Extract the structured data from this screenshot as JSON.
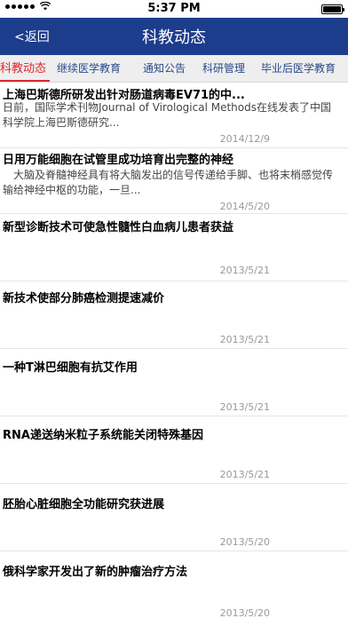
{
  "status_bar": {
    "time": "5:37 PM",
    "signal_icon": "signal-dots-icon",
    "wifi_icon": "wifi-icon",
    "battery_icon": "battery-icon"
  },
  "nav": {
    "back_label": "<返回",
    "title": "科教动态"
  },
  "tabs": [
    {
      "label": "科教动态",
      "active": true
    },
    {
      "label": "继续医学教育"
    },
    {
      "label": "通知公告"
    },
    {
      "label": "科研管理"
    },
    {
      "label": "毕业后医学教育"
    }
  ],
  "news": [
    {
      "title": "上海巴斯德所研发出针对肠道病毒EV71的中...",
      "summary": "日前，国际学术刊物Journal of Virological Methods在线发表了中国科学院上海巴斯德研究...",
      "date": "2014/12/9"
    },
    {
      "title": "日用万能细胞在试管里成功培育出完整的神经",
      "summary": "大脑及脊髓神经具有将大脑发出的信号传递给手脚、也将末梢感觉传输给神经中枢的功能，一旦...",
      "date": "2014/5/20"
    },
    {
      "title": "新型诊断技术可使急性髓性白血病儿患者获益",
      "summary": "",
      "date": "2013/5/21"
    },
    {
      "title": "新技术使部分肺癌检测提速减价",
      "summary": "",
      "date": "2013/5/21"
    },
    {
      "title": "一种T淋巴细胞有抗艾作用",
      "summary": "",
      "date": "2013/5/21"
    },
    {
      "title": "RNA递送纳米粒子系统能关闭特殊基因",
      "summary": "",
      "date": "2013/5/21"
    },
    {
      "title": "胚胎心脏细胞全功能研究获进展",
      "summary": "",
      "date": "2013/5/20"
    },
    {
      "title": "俄科学家开发出了新的肿瘤治疗方法",
      "summary": "",
      "date": "2013/5/20"
    }
  ]
}
